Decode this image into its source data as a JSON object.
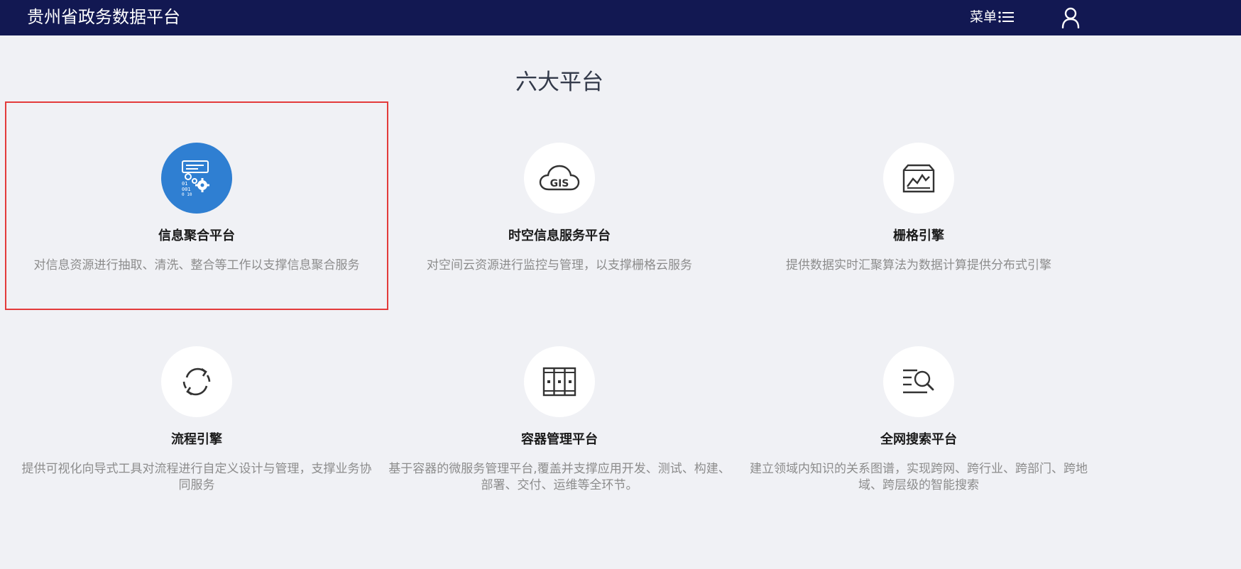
{
  "header": {
    "brand": "贵州省政务数据平台",
    "menu_label": "菜单",
    "menu_icon": "hamburger-icon",
    "user_icon": "user-icon"
  },
  "section": {
    "title": "六大平台"
  },
  "platforms": [
    {
      "title": "信息聚合平台",
      "desc": "对信息资源进行抽取、清洗、整合等工作以支撑信息聚合服务",
      "icon": "data-gears-icon",
      "selected": true
    },
    {
      "title": "时空信息服务平台",
      "desc": "对空间云资源进行监控与管理，以支撑栅格云服务",
      "icon": "gis-cloud-icon",
      "selected": false
    },
    {
      "title": "栅格引擎",
      "desc": "提供数据实时汇聚算法为数据计算提供分布式引擎",
      "icon": "raster-chart-icon",
      "selected": false
    },
    {
      "title": "流程引擎",
      "desc": "提供可视化向导式工具对流程进行自定义设计与管理，支撑业务协同服务",
      "icon": "refresh-cycle-icon",
      "selected": false
    },
    {
      "title": "容器管理平台",
      "desc": "基于容器的微服务管理平台,覆盖并支撑应用开发、测试、构建、部署、交付、运维等全环节。",
      "icon": "container-racks-icon",
      "selected": false
    },
    {
      "title": "全网搜索平台",
      "desc": "建立领域内知识的关系图谱，实现跨网、跨行业、跨部门、跨地域、跨层级的智能搜索",
      "icon": "list-search-icon",
      "selected": false
    }
  ],
  "colors": {
    "header_bg": "#121852",
    "page_bg": "#f0f1f5",
    "accent": "#2f7fd2",
    "highlight_border": "#e33b3b"
  }
}
